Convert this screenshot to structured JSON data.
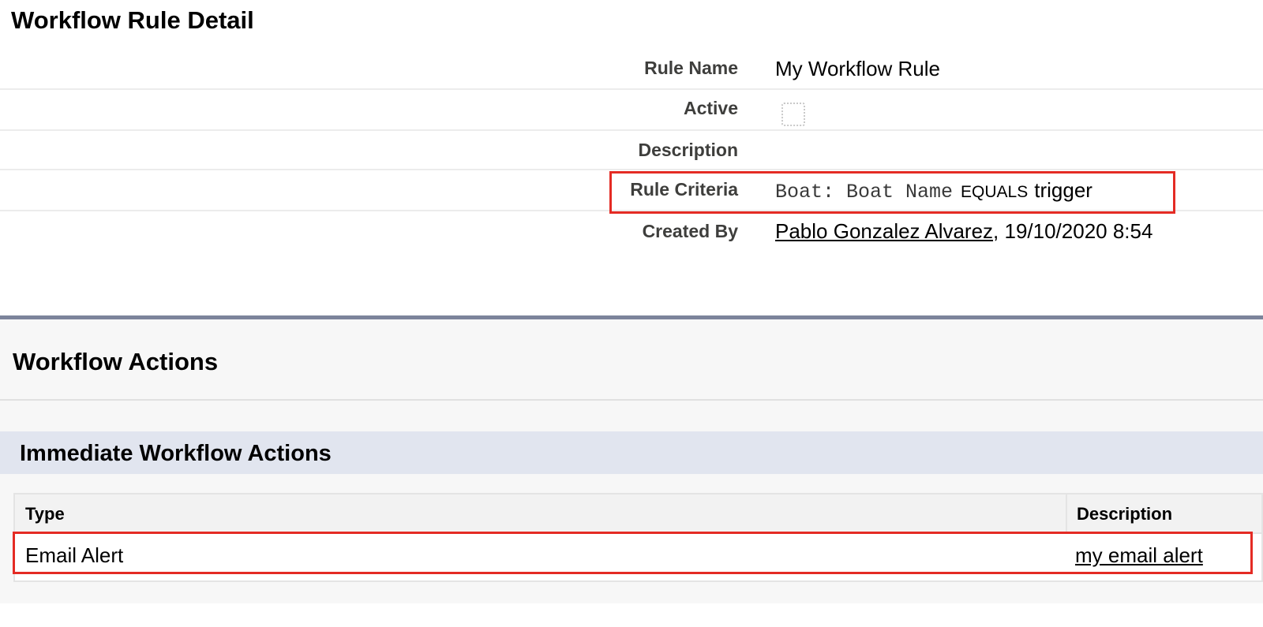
{
  "detail": {
    "title": "Workflow Rule Detail",
    "rule_name_label": "Rule Name",
    "rule_name_value": "My Workflow Rule",
    "active_label": "Active",
    "active_checked": false,
    "description_label": "Description",
    "description_value": "",
    "rule_criteria_label": "Rule Criteria",
    "rule_criteria_field": "Boat: Boat Name",
    "rule_criteria_operator": "EQUALS",
    "rule_criteria_value": "trigger",
    "created_by_label": "Created By",
    "created_by_user": "Pablo Gonzalez Alvarez",
    "created_by_date": ", 19/10/2020 8:54"
  },
  "actions": {
    "title": "Workflow Actions",
    "immediate_title": "Immediate Workflow Actions",
    "columns": {
      "type": "Type",
      "description": "Description"
    },
    "rows": [
      {
        "type": "Email Alert",
        "description": "my email alert"
      }
    ]
  },
  "colors": {
    "highlight": "#e42b24",
    "section_border": "#7c849b",
    "immediate_bar": "#e1e5ef"
  }
}
